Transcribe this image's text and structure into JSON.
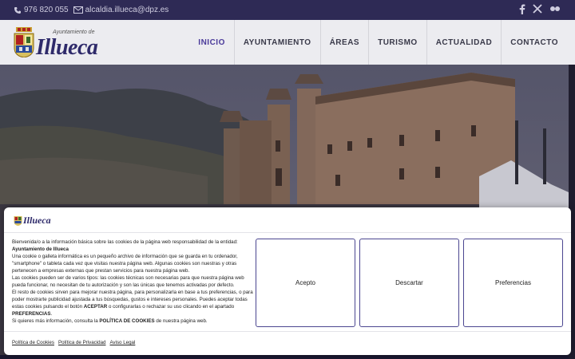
{
  "topbar": {
    "phone": "976 820 055",
    "email": "alcaldia.illueca@dpz.es",
    "social_icons": [
      "facebook-icon",
      "x-twitter-icon",
      "flickr-icon"
    ]
  },
  "header": {
    "logo_subtitle": "Ayuntamiento de",
    "logo_name": "Illueca",
    "nav": [
      {
        "label": "INICIO",
        "active": true
      },
      {
        "label": "AYUNTAMIENTO",
        "active": false
      },
      {
        "label": "ÁREAS",
        "active": false
      },
      {
        "label": "TURISMO",
        "active": false
      },
      {
        "label": "ACTUALIDAD",
        "active": false
      },
      {
        "label": "CONTACTO",
        "active": false
      }
    ]
  },
  "cookie": {
    "logo_name": "Illueca",
    "intro": "Bienvenida/o a la información básica sobre las cookies de la página web responsabilidad de la entidad:",
    "entity": "Ayuntamiento de Illueca",
    "para1": "Una cookie o galleta informática es un pequeño archivo de información que se guarda en tu ordenador, \"smartphone\" o tableta cada vez que visitas nuestra página web. Algunas cookies son nuestras y otras pertenecen a empresas externas que prestan servicios para nuestra página web.",
    "para2": "Las cookies pueden ser de varios tipos: las cookies técnicas son necesarias para que nuestra página web pueda funcionar, no necesitan de tu autorización y son las únicas que tenemos activadas por defecto.",
    "para3_a": "El resto de cookies sirven para mejorar nuestra página, para personalizarla en base a tus preferencias, o para poder mostrarte publicidad ajustada a tus búsquedas, gustos e intereses personales. Puedes aceptar todas estas cookies pulsando el botón ",
    "para3_accept": "ACEPTAR",
    "para3_b": " o configurarlas o rechazar su uso clicando en el apartado ",
    "para3_prefs": "PREFERENCIAS",
    "para3_c": ".",
    "para4_a": "Si quieres más información, consulta la ",
    "para4_policy": "POLÍTICA DE COOKIES",
    "para4_b": " de nuestra página web.",
    "buttons": {
      "accept": "Acepto",
      "decline": "Descartar",
      "preferences": "Preferencias"
    },
    "links": [
      "Política de Cookies",
      "Política de Privacidad",
      "Aviso Legal"
    ]
  },
  "colors": {
    "brand": "#2e2a55",
    "accent": "#4a3a9a"
  }
}
